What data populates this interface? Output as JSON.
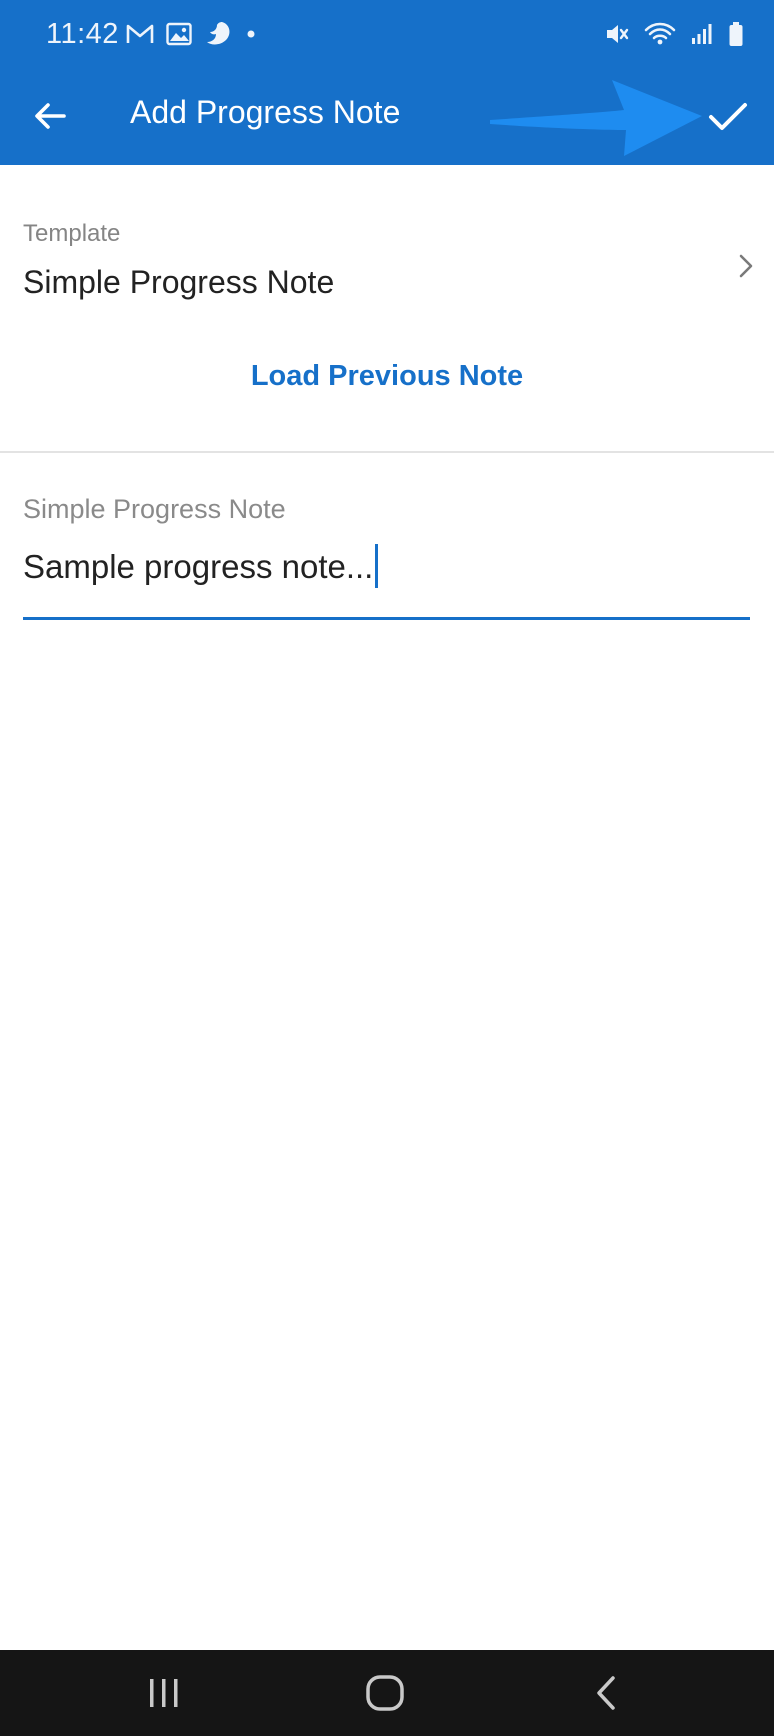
{
  "status_bar": {
    "time": "11:42",
    "left_icons": [
      "gmail-icon",
      "gallery-icon",
      "app-notification-icon",
      "dot-icon"
    ],
    "right_icons": [
      "mute-icon",
      "wifi-icon",
      "signal-icon",
      "battery-icon"
    ]
  },
  "app_bar": {
    "title": "Add Progress Note",
    "back_icon": "arrow-back-icon",
    "action_icon": "check-icon",
    "annotation_arrow_color": "#1e8cf0"
  },
  "template": {
    "label": "Template",
    "value": "Simple Progress Note"
  },
  "load_previous": {
    "label": "Load Previous Note"
  },
  "note": {
    "label": "Simple Progress Note",
    "value": "Sample progress note..."
  },
  "colors": {
    "primary": "#1670c9",
    "nav_bar": "#151515"
  },
  "nav_bar": {
    "items": [
      "recents-icon",
      "home-icon",
      "back-icon"
    ]
  }
}
